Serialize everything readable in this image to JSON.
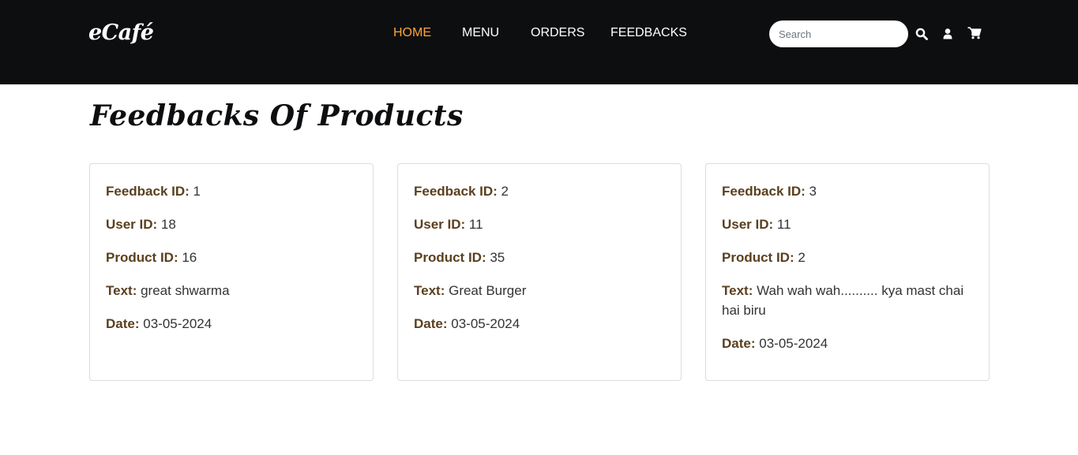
{
  "brand": "eCafé",
  "nav": {
    "links": [
      {
        "label": "HOME",
        "active": true
      },
      {
        "label": "MENU",
        "active": false
      },
      {
        "label": "ORDERS",
        "active": false
      },
      {
        "label": "FEEDBACKS",
        "active": false
      }
    ],
    "search_placeholder": "Search",
    "icons": [
      "search-icon",
      "user-icon",
      "cart-icon"
    ]
  },
  "page_title": "Feedbacks Of Products",
  "labels": {
    "feedback_id": "Feedback ID:",
    "user_id": "User ID:",
    "product_id": "Product ID:",
    "text": "Text:",
    "date": "Date:"
  },
  "feedbacks": [
    {
      "feedback_id": "1",
      "user_id": "18",
      "product_id": "16",
      "text": "great shwarma",
      "date": "03-05-2024"
    },
    {
      "feedback_id": "2",
      "user_id": "11",
      "product_id": "35",
      "text": "Great Burger",
      "date": "03-05-2024"
    },
    {
      "feedback_id": "3",
      "user_id": "11",
      "product_id": "2",
      "text": "Wah wah wah.......... kya mast chai hai biru",
      "date": "03-05-2024"
    }
  ],
  "colors": {
    "navbar_bg": "#0d0e10",
    "active_link": "#ffa539",
    "label_brown": "#5a401f",
    "card_border": "#dcdcdc"
  }
}
